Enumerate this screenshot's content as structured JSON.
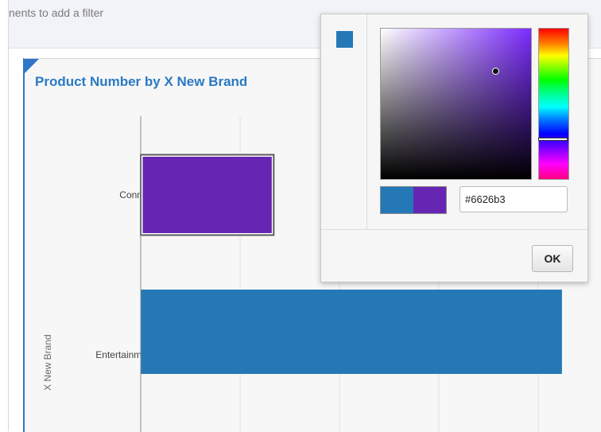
{
  "filter_bar": {
    "text": "nents to add a filter"
  },
  "chart_data": {
    "type": "bar",
    "orientation": "horizontal",
    "title": "Product Number by X New Brand",
    "ylabel": "X New Brand",
    "xlabel": "",
    "categories": [
      "Connect",
      "Entertainment"
    ],
    "values": [
      36,
      114
    ],
    "xlim": [
      0,
      125
    ],
    "bar_colors": [
      "#6626b3",
      "#2478b6"
    ],
    "selected_category": "Connect",
    "grid": true
  },
  "color_picker": {
    "current_color": "#2478b6",
    "hue_color": "#7b2bff",
    "previous_color": "#2478b6",
    "new_color": "#6626b3",
    "hex_value": "#6626b3",
    "ok_label": "OK"
  }
}
